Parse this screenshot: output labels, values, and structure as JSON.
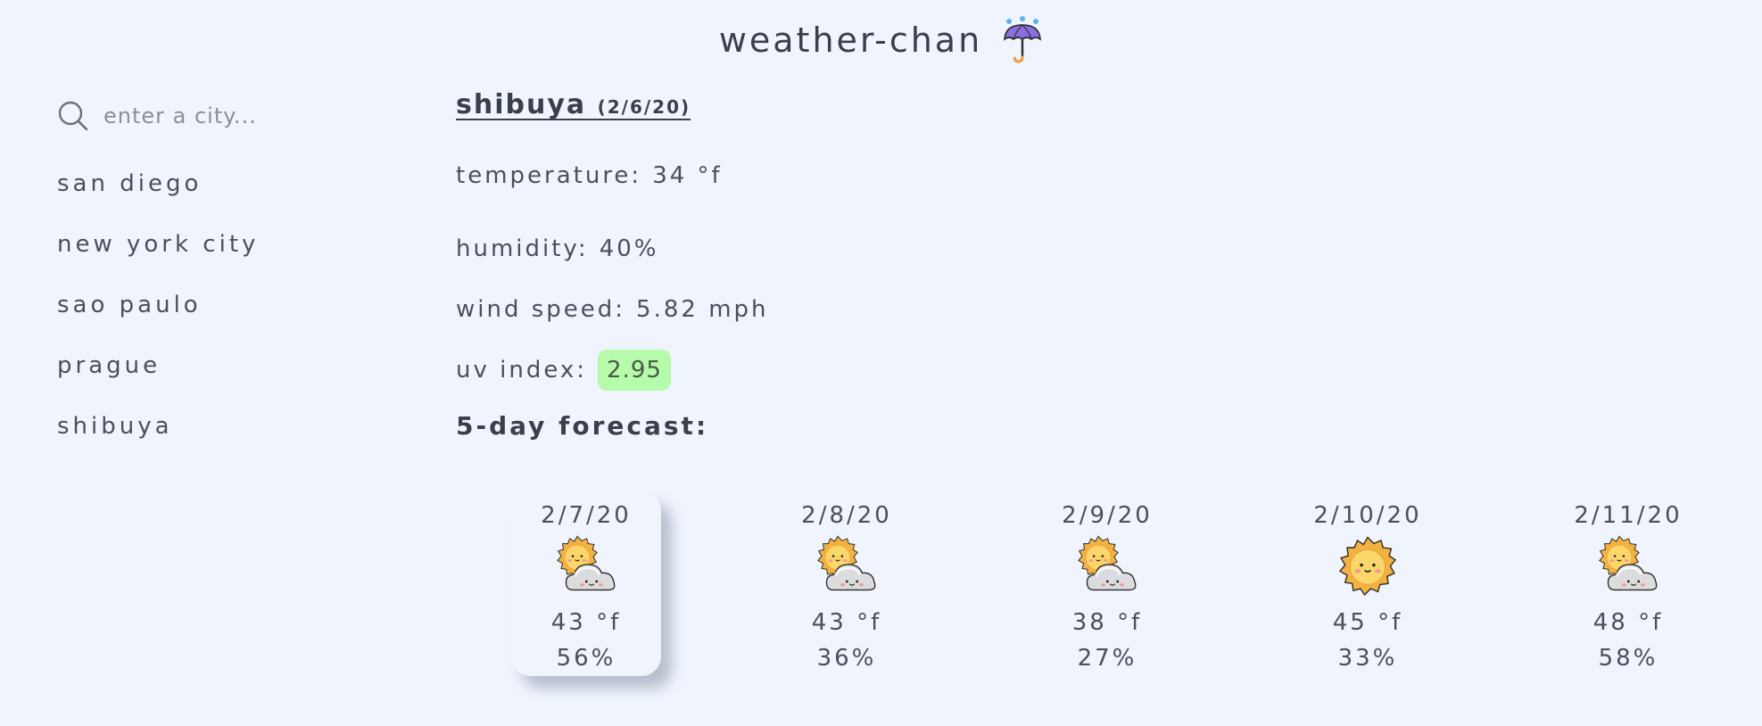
{
  "header": {
    "title": "weather-chan",
    "icon": "umbrella-icon"
  },
  "sidebar": {
    "search": {
      "placeholder": "enter a city...",
      "value": "",
      "icon": "search-icon"
    },
    "cities": [
      {
        "label": "san diego"
      },
      {
        "label": "new york city"
      },
      {
        "label": "sao paulo"
      },
      {
        "label": "prague"
      },
      {
        "label": "shibuya"
      }
    ]
  },
  "current": {
    "city": "shibuya",
    "date": "(2/6/20)",
    "temperature_label": "temperature:",
    "temperature_value": "34 °f",
    "humidity_label": "humidity:",
    "humidity_value": "40%",
    "wind_label": "wind speed:",
    "wind_value": "5.82 mph",
    "uv_label": "uv index:",
    "uv_value": "2.95",
    "uv_color": "#b6fbab"
  },
  "forecast": {
    "title": "5-day forecast:",
    "days": [
      {
        "date": "2/7/20",
        "icon": "partly-cloudy-icon",
        "temp": "43 °f",
        "humidity": "56%"
      },
      {
        "date": "2/8/20",
        "icon": "partly-cloudy-icon",
        "temp": "43 °f",
        "humidity": "36%"
      },
      {
        "date": "2/9/20",
        "icon": "partly-cloudy-icon",
        "temp": "38 °f",
        "humidity": "27%"
      },
      {
        "date": "2/10/20",
        "icon": "sun-icon",
        "temp": "45 °f",
        "humidity": "33%"
      },
      {
        "date": "2/11/20",
        "icon": "partly-cloudy-icon",
        "temp": "48 °f",
        "humidity": "58%"
      }
    ]
  },
  "colors": {
    "background": "#eff4fd",
    "text": "#3d4250",
    "sun": "#f7c653",
    "cloud": "#dcdcde"
  }
}
